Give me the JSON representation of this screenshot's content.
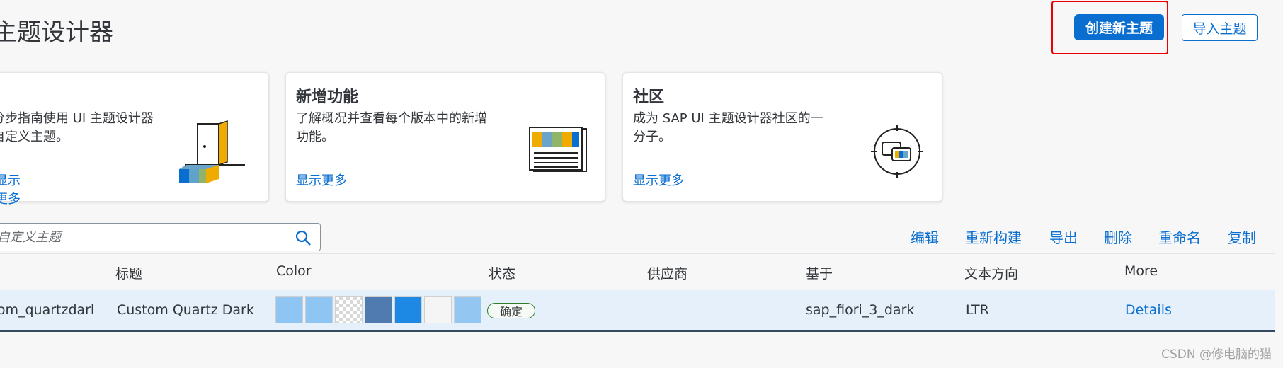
{
  "page": {
    "title": "主题设计器"
  },
  "header": {
    "create_label": "创建新主题",
    "import_label": "导入主题"
  },
  "cards": [
    {
      "heading": "",
      "text_line1": "分步指南使用 UI 主题设计器",
      "text_line2": "自定义主题。",
      "link": "显示更多",
      "icon": "door-icon"
    },
    {
      "heading": "新增功能",
      "text_line1": "了解概况并查看每个版本中的新增",
      "text_line2": "功能。",
      "link": "显示更多",
      "icon": "newspaper-icon"
    },
    {
      "heading": "社区",
      "text_line1": "成为 SAP UI 主题设计器社区的一",
      "text_line2": "分子。",
      "link": "显示更多",
      "icon": "community-chat-icon"
    }
  ],
  "search": {
    "placeholder": "自定义主题",
    "icon": "search-icon"
  },
  "toolbar": {
    "edit": "编辑",
    "rebuild": "重新构建",
    "export": "导出",
    "delete": "删除",
    "rename": "重命名",
    "copy": "复制"
  },
  "table": {
    "columns": {
      "id": "",
      "title": "标题",
      "color": "Color",
      "status": "状态",
      "vendor": "供应商",
      "based_on": "基于",
      "text_direction": "文本方向",
      "more": "More"
    },
    "rows": [
      {
        "id": "custom_quartzdark",
        "title": "Custom Quartz Dark",
        "colors": [
          "#8ec5f2",
          "#8ec5f2",
          "checker",
          "#4f7bb0",
          "#1e88e5",
          "#f5f5f5",
          "#93c6f0"
        ],
        "status": "确定",
        "vendor": "",
        "based_on": "sap_fiori_3_dark",
        "text_direction": "LTR",
        "more": "Details"
      }
    ]
  },
  "watermark": "CSDN @修电脑的猫",
  "colors": {
    "accent": "#0a6ed1",
    "highlight_border": "#e00000",
    "row_selected": "#e5f0fa"
  }
}
